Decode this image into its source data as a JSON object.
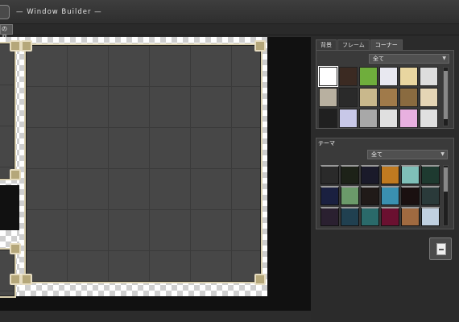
{
  "window": {
    "title": "— Window Builder —"
  },
  "toolbar": {
    "first_button": "の冊"
  },
  "tabs": [
    {
      "label": "背景"
    },
    {
      "label": "フレーム"
    },
    {
      "label": "コーナー"
    }
  ],
  "corner_filter": {
    "selected": "全て"
  },
  "theme": {
    "heading": "テーマ",
    "filter_selected": "全て"
  },
  "colors": {
    "frame_border": "#d9cfae",
    "panel_bg": "#474747",
    "accent_white": "#ffffff"
  },
  "corner_swatches": [
    "#ffffff",
    "#3b2a22",
    "#6fae3c",
    "#e8e8f0",
    "#e9d6a0",
    "#dddddd",
    "#b8b0a0",
    "#2a2a2a",
    "#c9b88c",
    "#a07a4a",
    "#8a6b40",
    "#e5d5b5",
    "#202020",
    "#c8c8e8",
    "#a8a8a8",
    "#e0e0e0",
    "#e8b0e0",
    "#e0e0e0"
  ],
  "theme_swatches": [
    "#2a2a2a",
    "#1d2218",
    "#1a1a2a",
    "#c07a20",
    "#7fbfb8",
    "#1e3a30",
    "#1a2040",
    "#6b9a6a",
    "#201a18",
    "#3a90b0",
    "#1a1010",
    "#2a3a3a",
    "#2a2030",
    "#204050",
    "#2a6a6a",
    "#6a1030",
    "#a06a40",
    "#c0d0e0"
  ],
  "icons": {
    "dropdown_arrow": "chevron-down-icon",
    "save": "save-icon"
  }
}
